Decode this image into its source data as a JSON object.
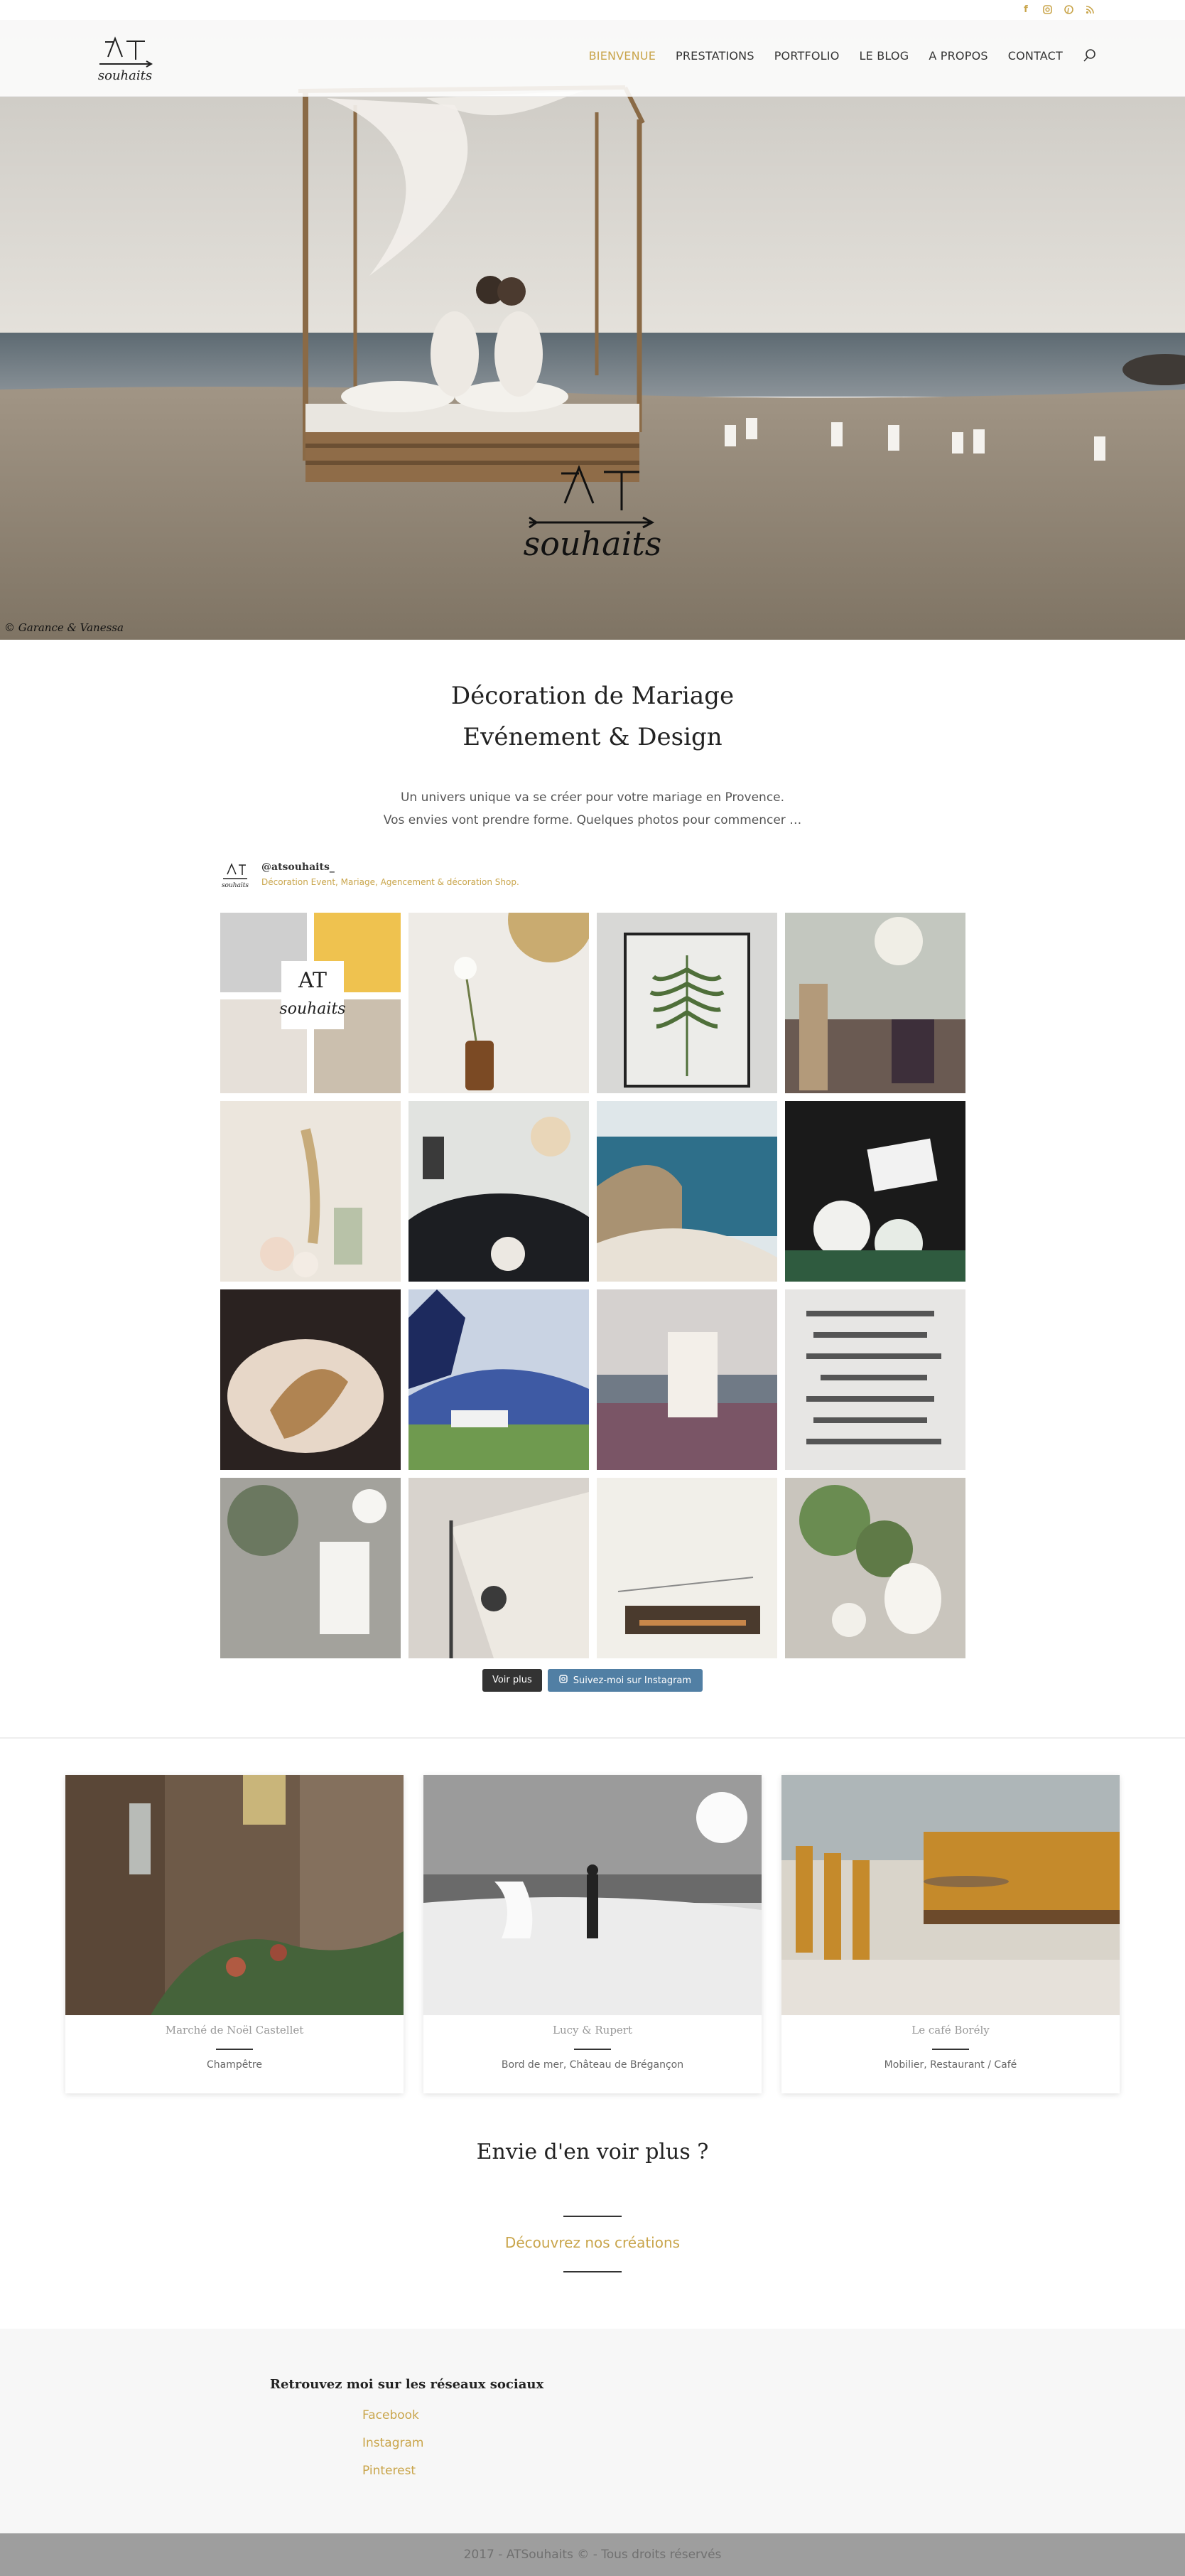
{
  "topbar": {
    "social": [
      "f",
      "instagram",
      "pinterest",
      "rss"
    ]
  },
  "header": {
    "logo_top": "AT",
    "logo_bottom": "souhaits",
    "nav": [
      {
        "label": "BIENVENUE",
        "active": true
      },
      {
        "label": "PRESTATIONS",
        "active": false
      },
      {
        "label": "PORTFOLIO",
        "active": false
      },
      {
        "label": "LE BLOG",
        "active": false
      },
      {
        "label": "A PROPOS",
        "active": false
      },
      {
        "label": "CONTACT",
        "active": false
      }
    ]
  },
  "hero": {
    "credit": "© Garance & Vanessa",
    "logo_top": "AT",
    "logo_bottom": "souhaits"
  },
  "intro": {
    "title_line1": "Décoration de Mariage",
    "title_line2": "Evénement & Design",
    "text_line1": "Un univers unique va se créer pour votre mariage en Provence.",
    "text_line2": "Vos envies vont prendre forme. Quelques photos pour commencer …"
  },
  "instagram": {
    "username": "@atsouhaits_",
    "bio": "Décoration Event, Mariage, Agencement & décoration Shop.",
    "load_more": "Voir plus",
    "follow": "Suivez-moi sur Instagram"
  },
  "portfolio": [
    {
      "title": "Marché de Noël Castellet",
      "subtitle": "Champêtre"
    },
    {
      "title": "Lucy & Rupert",
      "subtitle": "Bord de mer, Château de Brégançon"
    },
    {
      "title": "Le café Borély",
      "subtitle": "Mobilier, Restaurant / Café"
    }
  ],
  "more": {
    "title": "Envie d'en voir plus ?",
    "link": "Découvrez nos créations"
  },
  "footer": {
    "title": "Retrouvez moi sur les réseaux sociaux",
    "links": [
      "Facebook",
      "Instagram",
      "Pinterest"
    ],
    "copyright": "2017 - ATSouhaits © - Tous droits réservés"
  },
  "colors": {
    "accent": "#c9a54b",
    "dark": "#333333",
    "instagram_button": "#517fa4"
  }
}
